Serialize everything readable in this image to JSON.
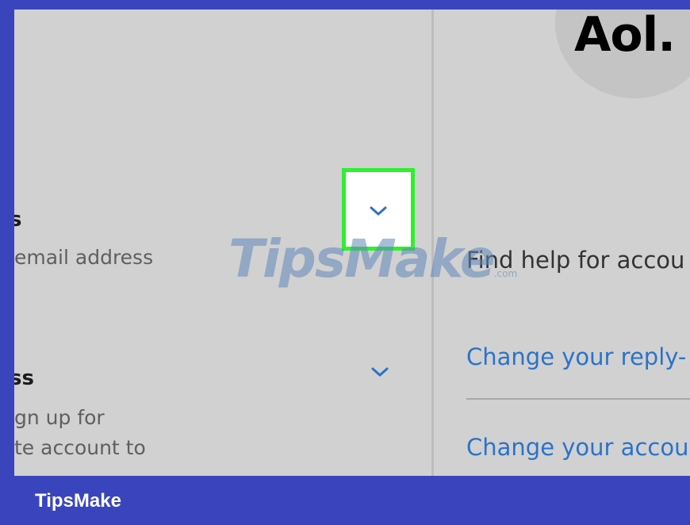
{
  "brand": {
    "logo_text": "Aol.",
    "footer_text": "TipsMake",
    "watermark_main": "TipsMake",
    "watermark_suffix": ".com"
  },
  "left_panel": {
    "sections": [
      {
        "title": "s",
        "description_lines": [
          "email address"
        ],
        "chevron_icon": "chevron-down-icon",
        "highlighted": true
      },
      {
        "title": "ss",
        "description_lines": [
          "gn up for",
          "te account to"
        ],
        "chevron_icon": "chevron-down-icon",
        "highlighted": false
      }
    ]
  },
  "right_panel": {
    "help_text": "Find help for accou",
    "links": [
      "Change your reply-",
      "Change your accou"
    ]
  },
  "colors": {
    "frame_blue": "#3a45bd",
    "screen_gray": "#d1d1d1",
    "link_blue": "#2a73c9",
    "highlight_green": "#2ef02e"
  }
}
